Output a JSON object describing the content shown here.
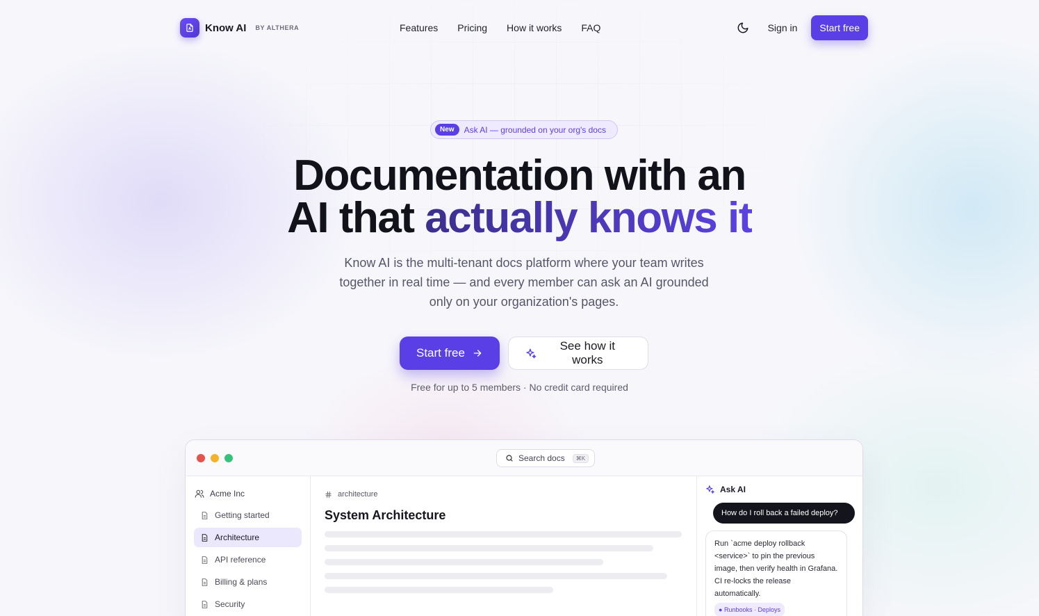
{
  "brand": {
    "name": "Know AI",
    "by": "BY ALTHERA",
    "accent": "#5b3fe6"
  },
  "nav": {
    "links": [
      "Features",
      "Pricing",
      "How it works",
      "FAQ"
    ],
    "theme_icon": "moon-icon",
    "signin": "Sign in",
    "start": "Start free"
  },
  "hero": {
    "badge_new": "New",
    "badge_text": "Ask AI — grounded on your org's docs",
    "title_line1": "Documentation with an",
    "title_line2_plain": "AI that ",
    "title_line2_grad": "actually knows it",
    "subtitle": "Know AI is the multi-tenant docs platform where your team writes together in real time — and every member can ask an AI grounded only on your organization's pages.",
    "cta_primary": "Start free",
    "cta_secondary": "See how it works",
    "fine": "Free for up to 5 members · No credit card required"
  },
  "app": {
    "window_dots": [
      "#e5534b",
      "#f2b32a",
      "#35c27a"
    ],
    "search_placeholder": "Search docs",
    "search_kbd": "⌘K",
    "org": "Acme Inc",
    "sidebar": [
      "Getting started",
      "Architecture",
      "API reference",
      "Billing & plans",
      "Security"
    ],
    "active_item": "Architecture",
    "breadcrumb": "architecture",
    "doc_title": "System Architecture",
    "ai_title": "Ask AI",
    "question": "How do I roll back a failed deploy?",
    "answer": "Run `acme deploy rollback <service>` to pin the previous image, then verify health in Grafana. CI re-locks the release automatically.",
    "source": "Runbooks · Deploys"
  }
}
